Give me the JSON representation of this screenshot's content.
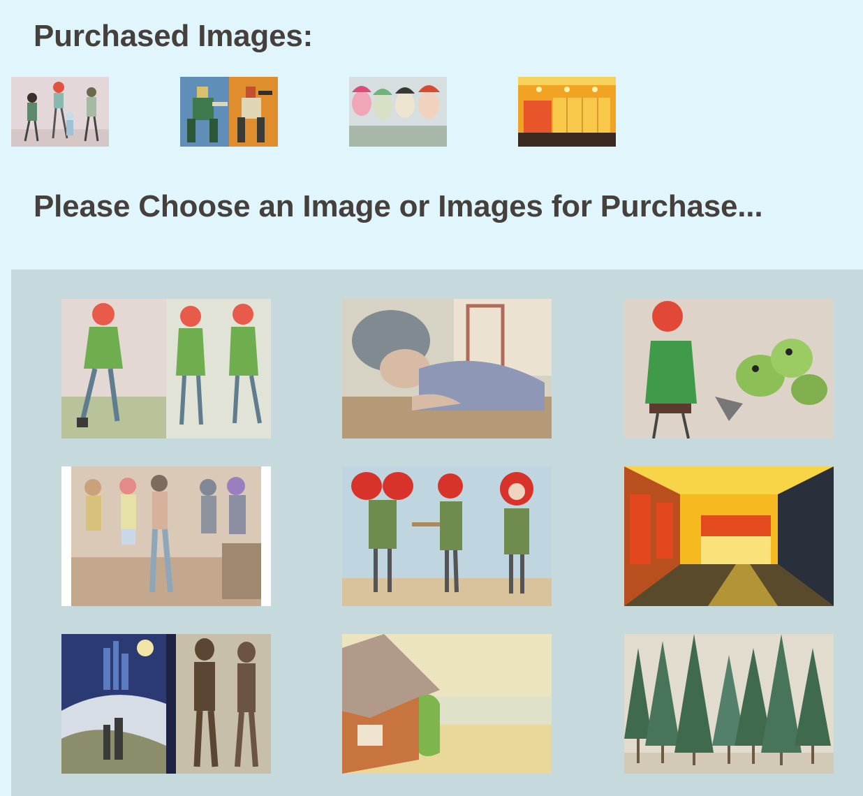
{
  "purchased": {
    "heading": "Purchased Images:",
    "thumbnails": [
      {
        "icon": "artwork-characters-group"
      },
      {
        "icon": "artwork-robots"
      },
      {
        "icon": "artwork-faces"
      },
      {
        "icon": "artwork-orange-room"
      }
    ]
  },
  "shop": {
    "heading": "Please Choose an Image or Images for Purchase...",
    "images": [
      {
        "icon": "artwork-redhead-walking"
      },
      {
        "icon": "artwork-boy-lying"
      },
      {
        "icon": "artwork-girl-monsters"
      },
      {
        "icon": "artwork-group-scene"
      },
      {
        "icon": "artwork-redhead-turnaround"
      },
      {
        "icon": "artwork-yellow-hallway"
      },
      {
        "icon": "artwork-robots-city"
      },
      {
        "icon": "artwork-house-field"
      },
      {
        "icon": "artwork-pine-trees"
      }
    ]
  },
  "colors": {
    "page_background": "#e1f5fc",
    "gallery_background": "#c6d9dc",
    "heading_text": "#45403c"
  }
}
